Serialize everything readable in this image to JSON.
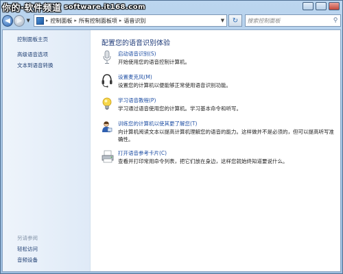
{
  "watermark": {
    "site_name": "你的·软件频道",
    "url": "software.it168.com"
  },
  "nav": {
    "breadcrumb": [
      "控制面板",
      "所有控制面板项",
      "语音识别"
    ],
    "search_placeholder": "搜索控制面板"
  },
  "sidebar": {
    "items": [
      "控制面板主页",
      "高级语音选项",
      "文本到语音转换"
    ],
    "see_also_heading": "另请参阅",
    "see_also": [
      "轻松访问",
      "音频设备"
    ]
  },
  "main": {
    "title": "配置您的语音识别体验",
    "items": [
      {
        "link": "启动语音识别(S)",
        "desc": "开始使用您的语音控制计算机。",
        "icon": "microphone-icon"
      },
      {
        "link": "设置麦克风(M)",
        "desc": "设置您的计算机以便能够正常使用语音识别功能。",
        "icon": "headset-icon"
      },
      {
        "link": "学习语音教程(P)",
        "desc": "学习通过语音使用您的计算机。学习基本命令和听写。",
        "icon": "lightbulb-icon"
      },
      {
        "link": "训练您的计算机以使其更了解您(T)",
        "desc": "向计算机阅读文本以提高计算机理解您的语音的能力。这样做并不是必须的，但可以提高听写准确性。",
        "icon": "user-training-icon"
      },
      {
        "link": "打开语音参考卡片(C)",
        "desc": "查看并打印常用命令列表，把它们放在身边，这样您就始终知道要说什么。",
        "icon": "printer-icon"
      }
    ]
  }
}
